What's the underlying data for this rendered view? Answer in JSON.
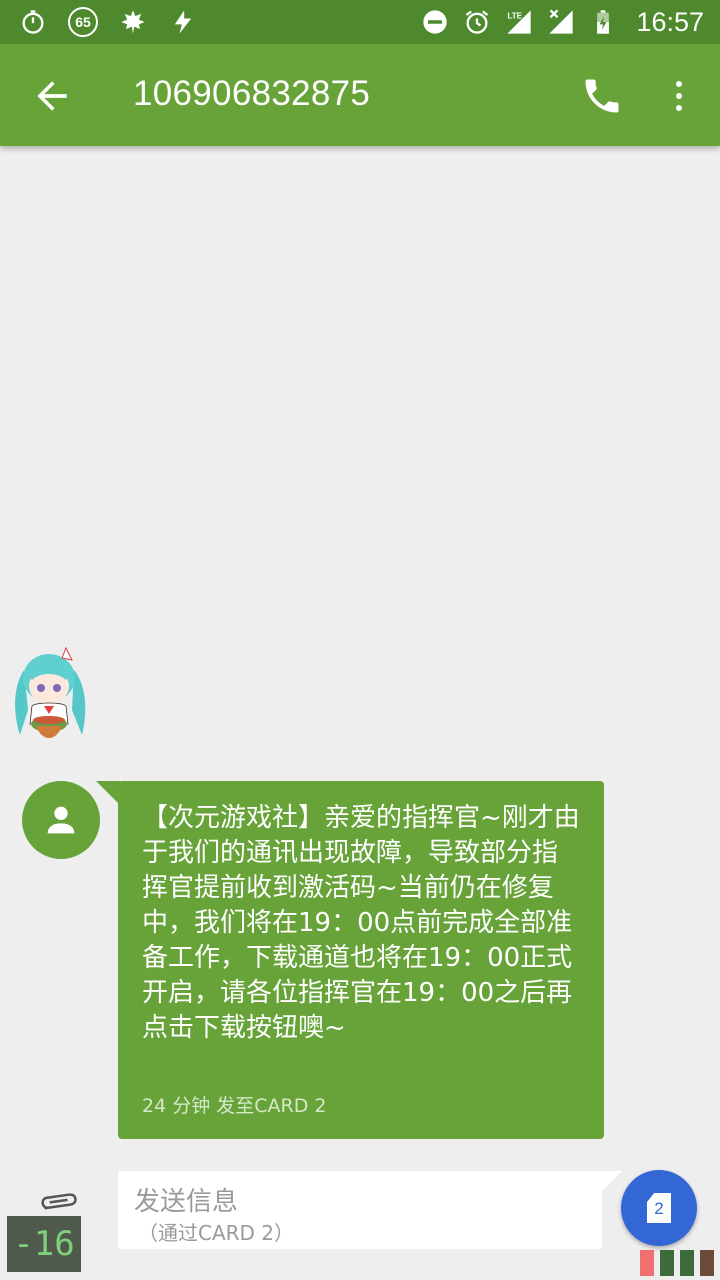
{
  "status_bar": {
    "time": "16:57",
    "battery_badge": "65",
    "network": "LTE",
    "icons": [
      "stopwatch-icon",
      "badge-65-icon",
      "leaf-icon",
      "flash-icon",
      "dnd-icon",
      "alarm-icon",
      "lte-signal-icon",
      "signal-x-icon",
      "battery-charging-icon"
    ]
  },
  "app_bar": {
    "title": "106906832875",
    "back_icon": "arrow-back-icon",
    "call_icon": "phone-icon",
    "more_icon": "more-vert-icon"
  },
  "conversation": {
    "messages": [
      {
        "text": "【次元游戏社】亲爱的指挥官~刚才由于我们的通讯出现故障，导致部分指挥官提前收到激活码~当前仍在修复中，我们将在19：00点前完成全部准备工作，下载通道也将在19：00正式开启，请各位指挥官在19：00之后再点击下载按钮噢~",
        "meta": "24 分钟  发至CARD 2",
        "avatar_icon": "person-icon"
      }
    ]
  },
  "compose": {
    "placeholder": "发送信息",
    "sub_label": "（通过CARD 2）",
    "sim_number": "2",
    "attach_icon": "paperclip-icon"
  },
  "overlay": {
    "counter": "-16"
  },
  "colors": {
    "status_bar": "#4e8a2d",
    "app_bar": "#67a339",
    "bubble": "#67a339",
    "background": "#eeeeee",
    "fab": "#3367d6"
  }
}
